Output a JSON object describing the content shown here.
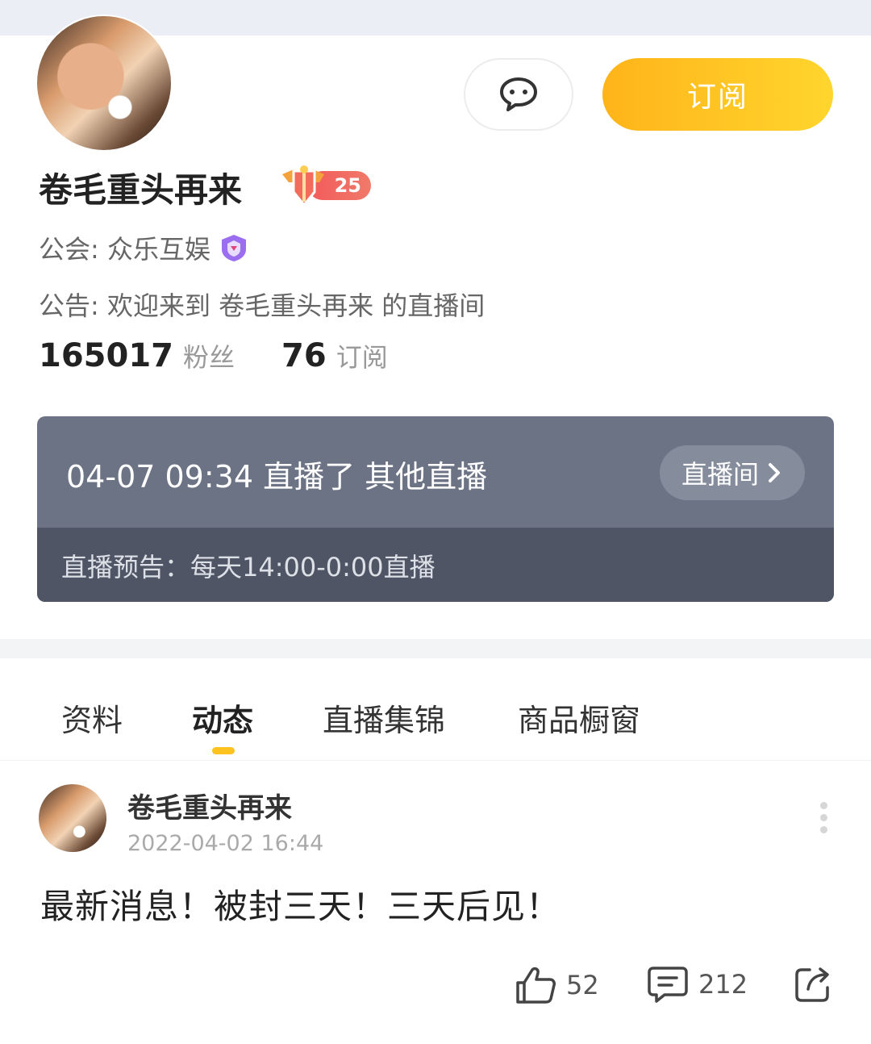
{
  "profile": {
    "name": "卷毛重头再来",
    "level": "25",
    "guild_label": "公会: 众乐互娱",
    "notice_label": "公告: 欢迎来到 卷毛重头再来 的直播间",
    "fans_count": "165017",
    "fans_label": "粉丝",
    "subs_count": "76",
    "subs_label": "订阅"
  },
  "actions": {
    "subscribe_label": "订阅",
    "message_icon": "chat-bubble-icon"
  },
  "live": {
    "status_text": "04-07 09:34 直播了 其他直播",
    "room_label": "直播间",
    "preview_text": "直播预告：每天14:00-0:00直播"
  },
  "tabs": [
    {
      "label": "资料"
    },
    {
      "label": "动态"
    },
    {
      "label": "直播集锦"
    },
    {
      "label": "商品橱窗"
    }
  ],
  "post": {
    "author": "卷毛重头再来",
    "time": "2022-04-02 16:44",
    "content": "最新消息！被封三天！三天后见！",
    "likes": "52",
    "comments": "212"
  },
  "colors": {
    "accent": "#ffc21f",
    "subscribe_start": "#ffb41a",
    "subscribe_end": "#ffd52d",
    "live_card": "#6b7385",
    "live_card_bottom": "#4f5565",
    "level_badge": "#f25a5a"
  }
}
